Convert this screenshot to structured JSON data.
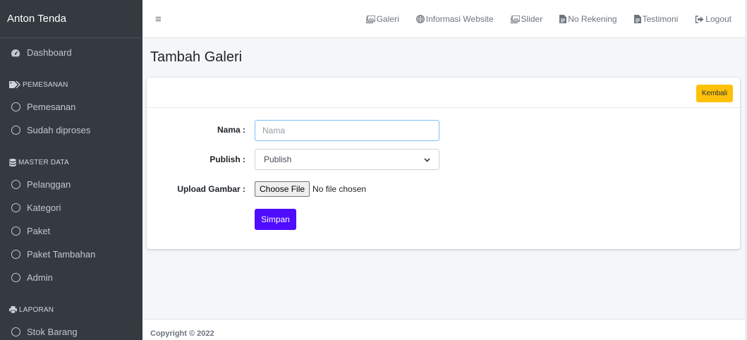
{
  "brand": "Anton Tenda",
  "sidebar": {
    "dashboard": "Dashboard",
    "header_pemesanan": "PEMESANAN",
    "pemesanan": "Pemesanan",
    "sudah_diproses": "Sudah diproses",
    "header_master": "MASTER DATA",
    "pelanggan": "Pelanggan",
    "kategori": "Kategori",
    "paket": "Paket",
    "paket_tambahan": "Paket Tambahan",
    "admin": "Admin",
    "header_laporan": "LAPORAN",
    "stok_barang": "Stok Barang"
  },
  "topnav": {
    "hamburger": "≡",
    "galeri": "Galeri",
    "informasi_website": "Informasi Website",
    "slider": "Slider",
    "no_rekening": "No Rekening",
    "testimoni": "Testimoni",
    "logout": "Logout"
  },
  "page": {
    "title": "Tambah Galeri",
    "back_button": "Kembali"
  },
  "form": {
    "nama_label": "Nama :",
    "nama_placeholder": "Nama",
    "publish_label": "Publish :",
    "publish_value": "Publish",
    "upload_label": "Upload Gambar :",
    "file_button": "Choose File",
    "file_status": "No file chosen",
    "save_button": "Simpan"
  },
  "footer": "Copyright © 2022",
  "colors": {
    "sidebar_bg": "#343a40",
    "back_button": "#ffc107",
    "save_button": "#4f0cff"
  }
}
